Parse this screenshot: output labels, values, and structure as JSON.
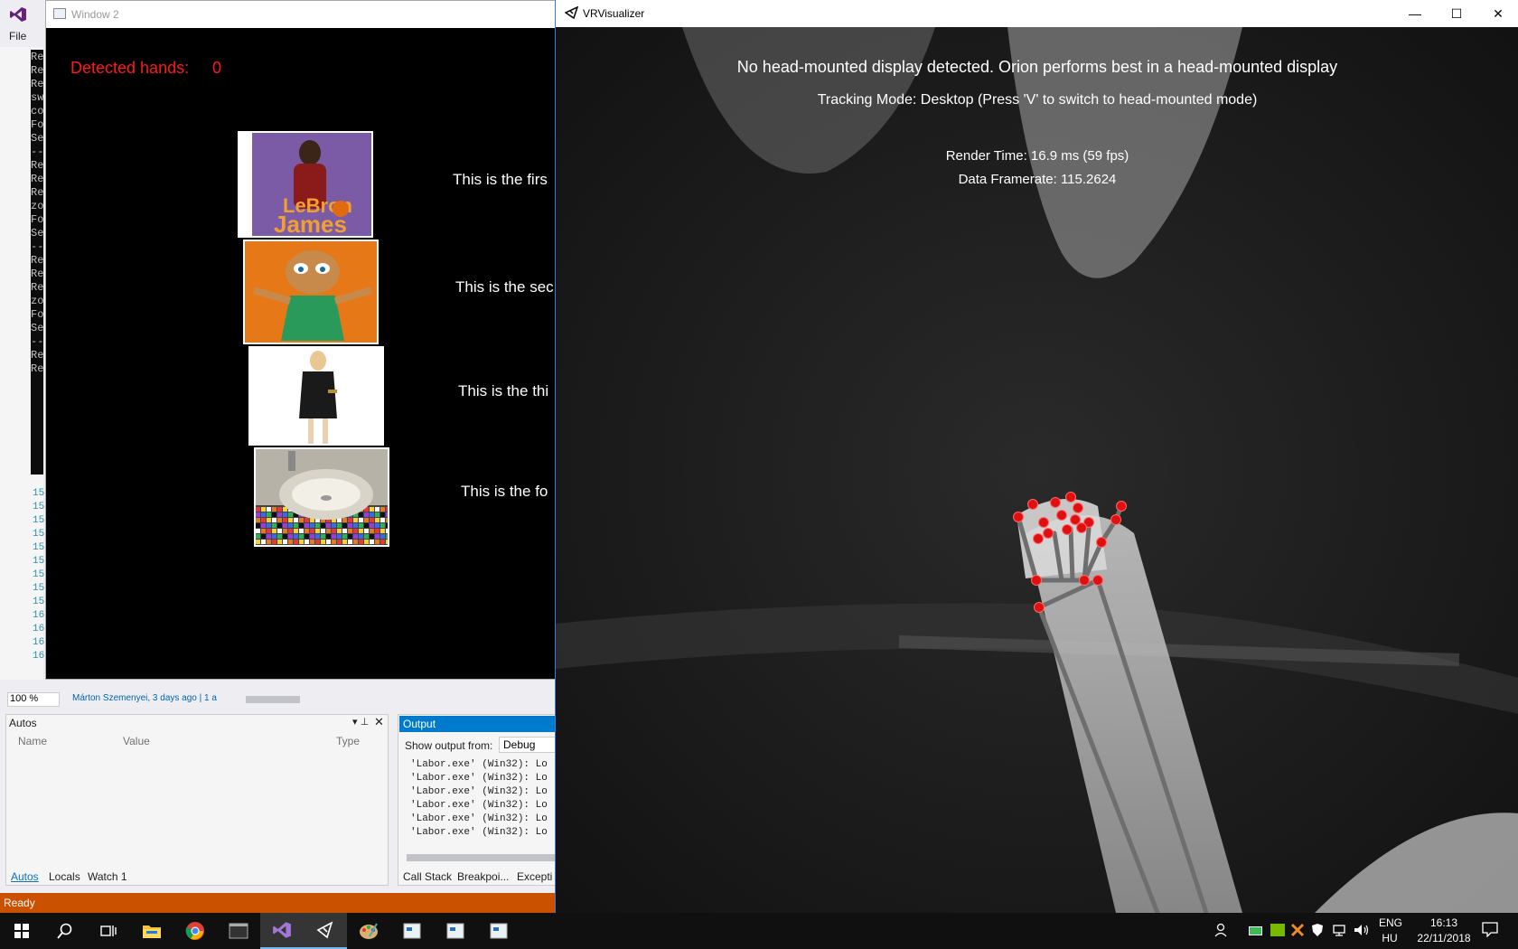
{
  "visual_studio": {
    "menu_file": "File",
    "console_prefixes": [
      "Re",
      "Re",
      "Re",
      "sw",
      "com",
      "Fo",
      "Se",
      "--",
      "Re",
      "Re",
      "Re",
      "zo",
      "Fo",
      "Se",
      "--",
      "Re",
      "Re",
      "Re",
      "zo",
      "Fo",
      "Se",
      "--",
      "Re",
      "Re"
    ],
    "line_numbers": [
      "15",
      "15",
      "15",
      "15",
      "15",
      "15",
      "15",
      "15",
      "15",
      "16",
      "16",
      "16",
      "16"
    ],
    "zoom": "100 %",
    "blame": "Márton Szemenyei, 3 days ago | 1 a",
    "autos": {
      "title": "Autos",
      "col_name": "Name",
      "col_value": "Value",
      "col_type": "Type",
      "tabs": [
        "Autos",
        "Locals",
        "Watch 1"
      ]
    },
    "output": {
      "title": "Output",
      "show_from": "Show output from:",
      "source": "Debug",
      "lines": [
        "'Labor.exe' (Win32): Lo",
        "'Labor.exe' (Win32): Lo",
        "'Labor.exe' (Win32): Lo",
        "'Labor.exe' (Win32): Lo",
        "'Labor.exe' (Win32): Lo",
        "'Labor.exe' (Win32): Lo"
      ],
      "tabs": [
        "Call Stack",
        "Breakpoi...",
        "Excepti"
      ]
    },
    "status": "Ready"
  },
  "window2": {
    "title": "Window 2",
    "detected_label": "Detected hands:",
    "detected_value": "0",
    "rows": [
      {
        "text": "This is the firs",
        "image": "LeBron James book cover"
      },
      {
        "text": "This is the sec",
        "image": "chipmunk in green dress"
      },
      {
        "text": "This is the thi",
        "image": "woman in black dress"
      },
      {
        "text": "This is the fo",
        "image": "mosaic sink"
      }
    ]
  },
  "vrvisualizer": {
    "title": "VRVisualizer",
    "heading": "No head-mounted display detected. Orion performs best in a head-mounted display",
    "tracking": "Tracking Mode: Desktop (Press 'V' to switch to head-mounted mode)",
    "render_time": "Render Time: 16.9 ms (59 fps)",
    "data_framerate": "Data Framerate: 115.2624",
    "minimize": "—",
    "maximize": "☐",
    "close": "✕"
  },
  "taskbar": {
    "lang1": "ENG",
    "lang2": "HU",
    "time": "16:13",
    "date": "22/11/2018",
    "apps": [
      "windows-start",
      "search",
      "task-view",
      "file-explorer",
      "chrome",
      "terminal",
      "visual-studio",
      "unity",
      "paint",
      "window-a",
      "window-b",
      "window-c"
    ]
  },
  "colors": {
    "vs_status": "#ca5100",
    "output_title": "#007acc",
    "detected": "#ff1a1a",
    "joint": "#e01010"
  }
}
